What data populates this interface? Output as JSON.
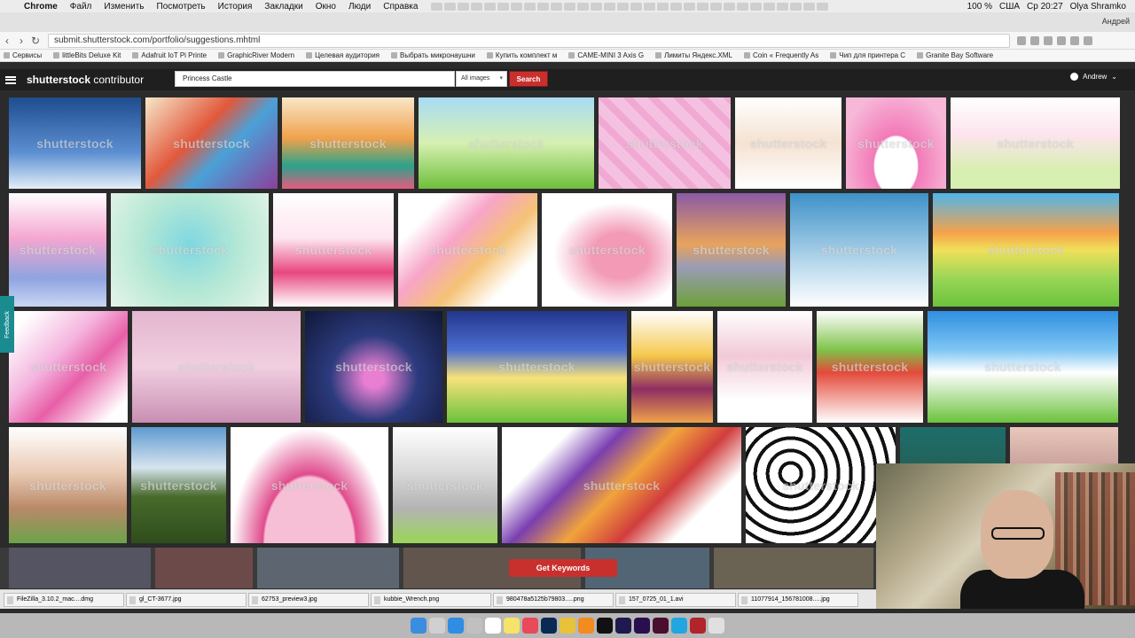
{
  "mac_menubar": {
    "app": "Chrome",
    "items": [
      "Файл",
      "Изменить",
      "Посмотреть",
      "История",
      "Закладки",
      "Окно",
      "Люди",
      "Справка"
    ],
    "battery": "100 %",
    "keyboard": "США",
    "clock": "Ср 20:27",
    "user": "Olya Shramko"
  },
  "browser": {
    "profile_label": "Андрей",
    "url": "submit.shutterstock.com/portfolio/suggestions.mhtml",
    "bookmarks": [
      "Сервисы",
      "littleBits Deluxe Kit",
      "Adafruit IoT Pi Printe",
      "GraphicRiver Modern",
      "Целевая аудитория",
      "Выбрать микронаушни",
      "Купить комплект м",
      "CAME-MINI 3 Axis G",
      "Лимиты Яндекс.XML",
      "Coin « Frequently As",
      "Чип для принтера С",
      "Granite Bay Software"
    ]
  },
  "site_header": {
    "logo_main": "shutterstock",
    "logo_sub": "contributor",
    "search_value": "Princess Castle",
    "filter_selected": "All images",
    "search_button": "Search",
    "user_name": "Andrew"
  },
  "watermark": "shutterstock",
  "feedback_tab": "Feedback",
  "get_keywords": "Get Keywords",
  "downloads": [
    "FileZilla_3.10.2_mac....dmg",
    "gl_CT-3677.jpg",
    "62753_preview3.jpg",
    "kubbie_Wrench.png",
    "980478a5125b79803.....png",
    "157_0725_01_1.avi",
    "11077914_156781008.....jpg"
  ],
  "colors": {
    "header_bg": "#1f1f1f",
    "search_red": "#c8302e",
    "feedback_teal": "#1a8b8f"
  }
}
